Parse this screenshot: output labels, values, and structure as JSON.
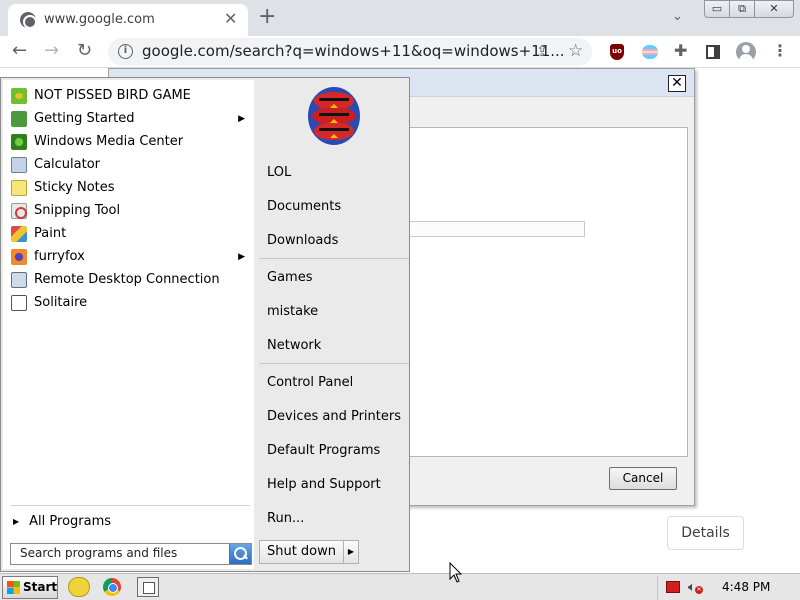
{
  "browser": {
    "tab_title": "www.google.com",
    "tab_close": "✕",
    "new_tab": "+",
    "tab_search_icon": "chevron-down-icon",
    "url": "google.com/search?q=windows+11&oq=windows+11...",
    "window_controls": {
      "minimize": "▭",
      "restore": "⧉",
      "close": "✕"
    },
    "nav": {
      "back": "←",
      "forward": "→",
      "reload": "↻"
    },
    "extensions": [
      "ublock-origin-icon",
      "flag-extension-icon",
      "puzzle-icon",
      "side-panel-icon",
      "profile-icon"
    ],
    "menu": "⋮"
  },
  "dialog": {
    "close_glyph": "✕",
    "cancel_label": "Cancel"
  },
  "page": {
    "details_label": "Details"
  },
  "start_menu": {
    "programs": [
      {
        "label": "NOT PISSED BIRD GAME",
        "icon": "bird-game-icon",
        "submenu": false
      },
      {
        "label": "Getting Started",
        "icon": "getting-started-icon",
        "submenu": true
      },
      {
        "label": "Windows Media Center",
        "icon": "media-center-icon",
        "submenu": false
      },
      {
        "label": "Calculator",
        "icon": "calculator-icon",
        "submenu": false
      },
      {
        "label": "Sticky Notes",
        "icon": "sticky-notes-icon",
        "submenu": false
      },
      {
        "label": "Snipping Tool",
        "icon": "snipping-tool-icon",
        "submenu": false
      },
      {
        "label": "Paint",
        "icon": "paint-icon",
        "submenu": false
      },
      {
        "label": "furryfox",
        "icon": "firefox-icon",
        "submenu": true
      },
      {
        "label": "Remote Desktop Connection",
        "icon": "remote-desktop-icon",
        "submenu": false
      },
      {
        "label": "Solitaire",
        "icon": "solitaire-icon",
        "submenu": false
      }
    ],
    "submenu_arrow": "▶",
    "all_programs": "All Programs",
    "all_programs_arrow": "▶",
    "search_placeholder": "Search programs and files",
    "right_links": {
      "group1": [
        "LOL",
        "Documents",
        "Downloads"
      ],
      "group2": [
        "Games",
        "mistake",
        "Network"
      ],
      "group3": [
        "Control Panel",
        "Devices and Printers",
        "Default Programs",
        "Help and Support",
        "Run..."
      ]
    },
    "shutdown_label": "Shut down",
    "shutdown_arrow": "▶"
  },
  "taskbar": {
    "start_label": "Start",
    "pinned": [
      "bird-game-icon",
      "chrome-icon",
      "dialog-window-icon"
    ],
    "tray": [
      "action-center-flag-icon",
      "volume-muted-icon"
    ],
    "clock": "4:48 PM"
  },
  "colors": {
    "taskbar": "#e6e6e6",
    "start_menu_left": "#ffffff",
    "start_menu_right": "#eaeaea",
    "chrome_titlebar": "#dee1e6",
    "omnibox": "#f1f3f4"
  }
}
